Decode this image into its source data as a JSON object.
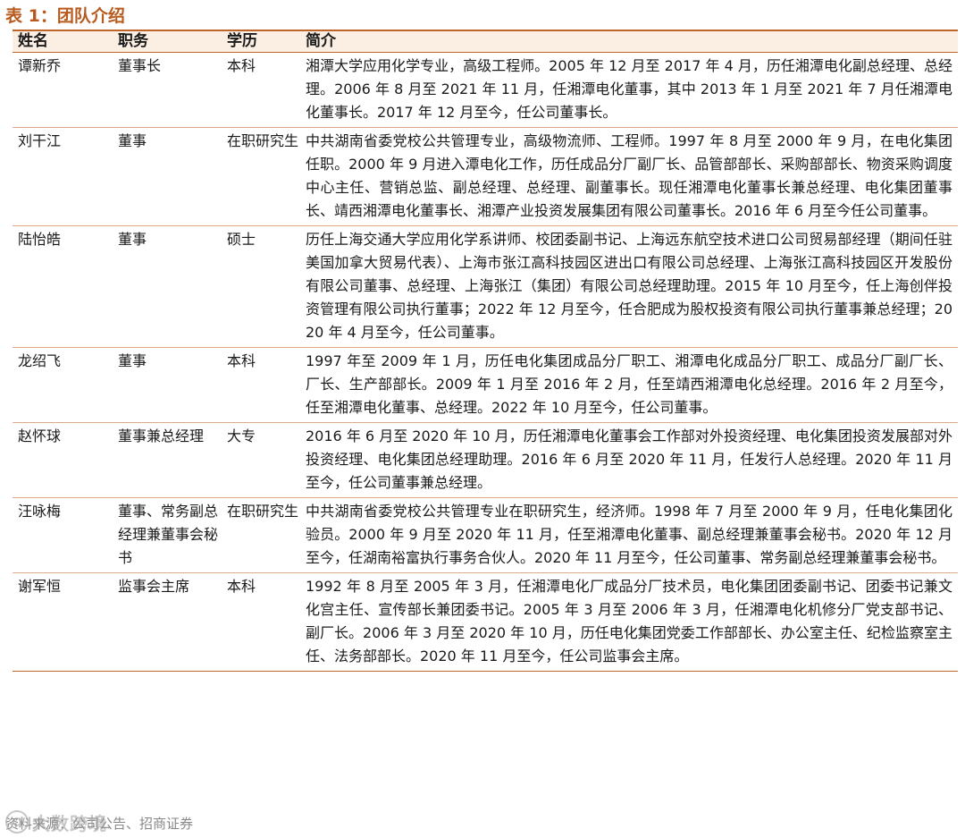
{
  "table_title": "表 1：团队介绍",
  "columns": [
    "姓名",
    "职务",
    "学历",
    "简介"
  ],
  "rows": [
    {
      "name": "谭新乔",
      "position": "董事长",
      "education": "本科",
      "intro": "湘潭大学应用化学专业，高级工程师。2005 年 12 月至 2017 年 4 月，历任湘潭电化副总经理、总经理。2006 年 8 月至 2021 年 11 月，任湘潭电化董事，其中 2013 年 1 月至 2021 年 7 月任湘潭电化董事长。2017 年 12 月至今，任公司董事长。"
    },
    {
      "name": "刘干江",
      "position": "董事",
      "education": "在职研究生",
      "intro": "中共湖南省委党校公共管理专业，高级物流师、工程师。1997 年 8 月至 2000 年 9 月，在电化集团任职。2000 年 9 月进入潭电化工作，历任成品分厂副厂长、品管部部长、采购部部长、物资采购调度中心主任、营销总监、副总经理、总经理、副董事长。现任湘潭电化董事长兼总经理、电化集团董事长、靖西湘潭电化董事长、湘潭产业投资发展集团有限公司董事长。2016 年 6 月至今任公司董事。"
    },
    {
      "name": "陆怡皓",
      "position": "董事",
      "education": "硕士",
      "intro": "历任上海交通大学应用化学系讲师、校团委副书记、上海远东航空技术进口公司贸易部经理（期间任驻美国加拿大贸易代表）、上海市张江高科技园区进出口有限公司总经理、上海张江高科技园区开发股份有限公司董事、总经理、上海张江（集团）有限公司总经理助理。2015 年 10 月至今，任上海创伴投资管理有限公司执行董事；2022 年 12 月至今，任合肥成为股权投资有限公司执行董事兼总经理；2020 年 4 月至今，任公司董事。"
    },
    {
      "name": "龙绍飞",
      "position": "董事",
      "education": "本科",
      "intro": "1997 年至 2009 年 1 月，历任电化集团成品分厂职工、湘潭电化成品分厂职工、成品分厂副厂长、厂长、生产部部长。2009 年 1 月至 2016 年 2 月，任至靖西湘潭电化总经理。2016 年 2 月至今，任至湘潭电化董事、总经理。2022 年 10 月至今，任公司董事。"
    },
    {
      "name": "赵怀球",
      "position": "董事兼总经理",
      "education": "大专",
      "intro": "2016 年 6 月至 2020 年 10 月，历任湘潭电化董事会工作部对外投资经理、电化集团投资发展部对外投资经理、电化集团总经理助理。2016 年 6 月至 2020 年 11 月，任发行人总经理。2020 年 11 月至今，任公司董事兼总经理。"
    },
    {
      "name": "汪咏梅",
      "position": "董事、常务副总经理兼董事会秘书",
      "education": "在职研究生",
      "intro": "中共湖南省委党校公共管理专业在职研究生，经济师。1998 年 7 月至 2000 年 9 月，任电化集团化验员。2000 年 9 月至 2020 年 11 月，任至湘潭电化董事、副总经理兼董事会秘书。2020 年 12 月至今，任湖南裕富执行事务合伙人。2020 年 11 月至今，任公司董事、常务副总经理兼董事会秘书。"
    },
    {
      "name": "谢军恒",
      "position": "监事会主席",
      "education": "本科",
      "intro": "1992 年 8 月至 2005 年 3 月，任湘潭电化厂成品分厂技术员，电化集团团委副书记、团委书记兼文化宫主任、宣传部长兼团委书记。2005 年 3 月至 2006 年 3 月，任湘潭电化机修分厂党支部书记、副厂长。2006 年 3 月至 2020 年 10 月，历任电化集团党委工作部部长、办公室主任、纪检监察室主任、法务部部长。2020 年 11 月至今，任公司监事会主席。"
    }
  ],
  "source": "资料来源：公司公告、招商证券",
  "watermark": {
    "icon": "watermark-logo-icon",
    "text": "大数跨境"
  },
  "colors": {
    "title": "#b85a1e",
    "rule": "#c0652a",
    "header_bg": "#fbeee3"
  }
}
